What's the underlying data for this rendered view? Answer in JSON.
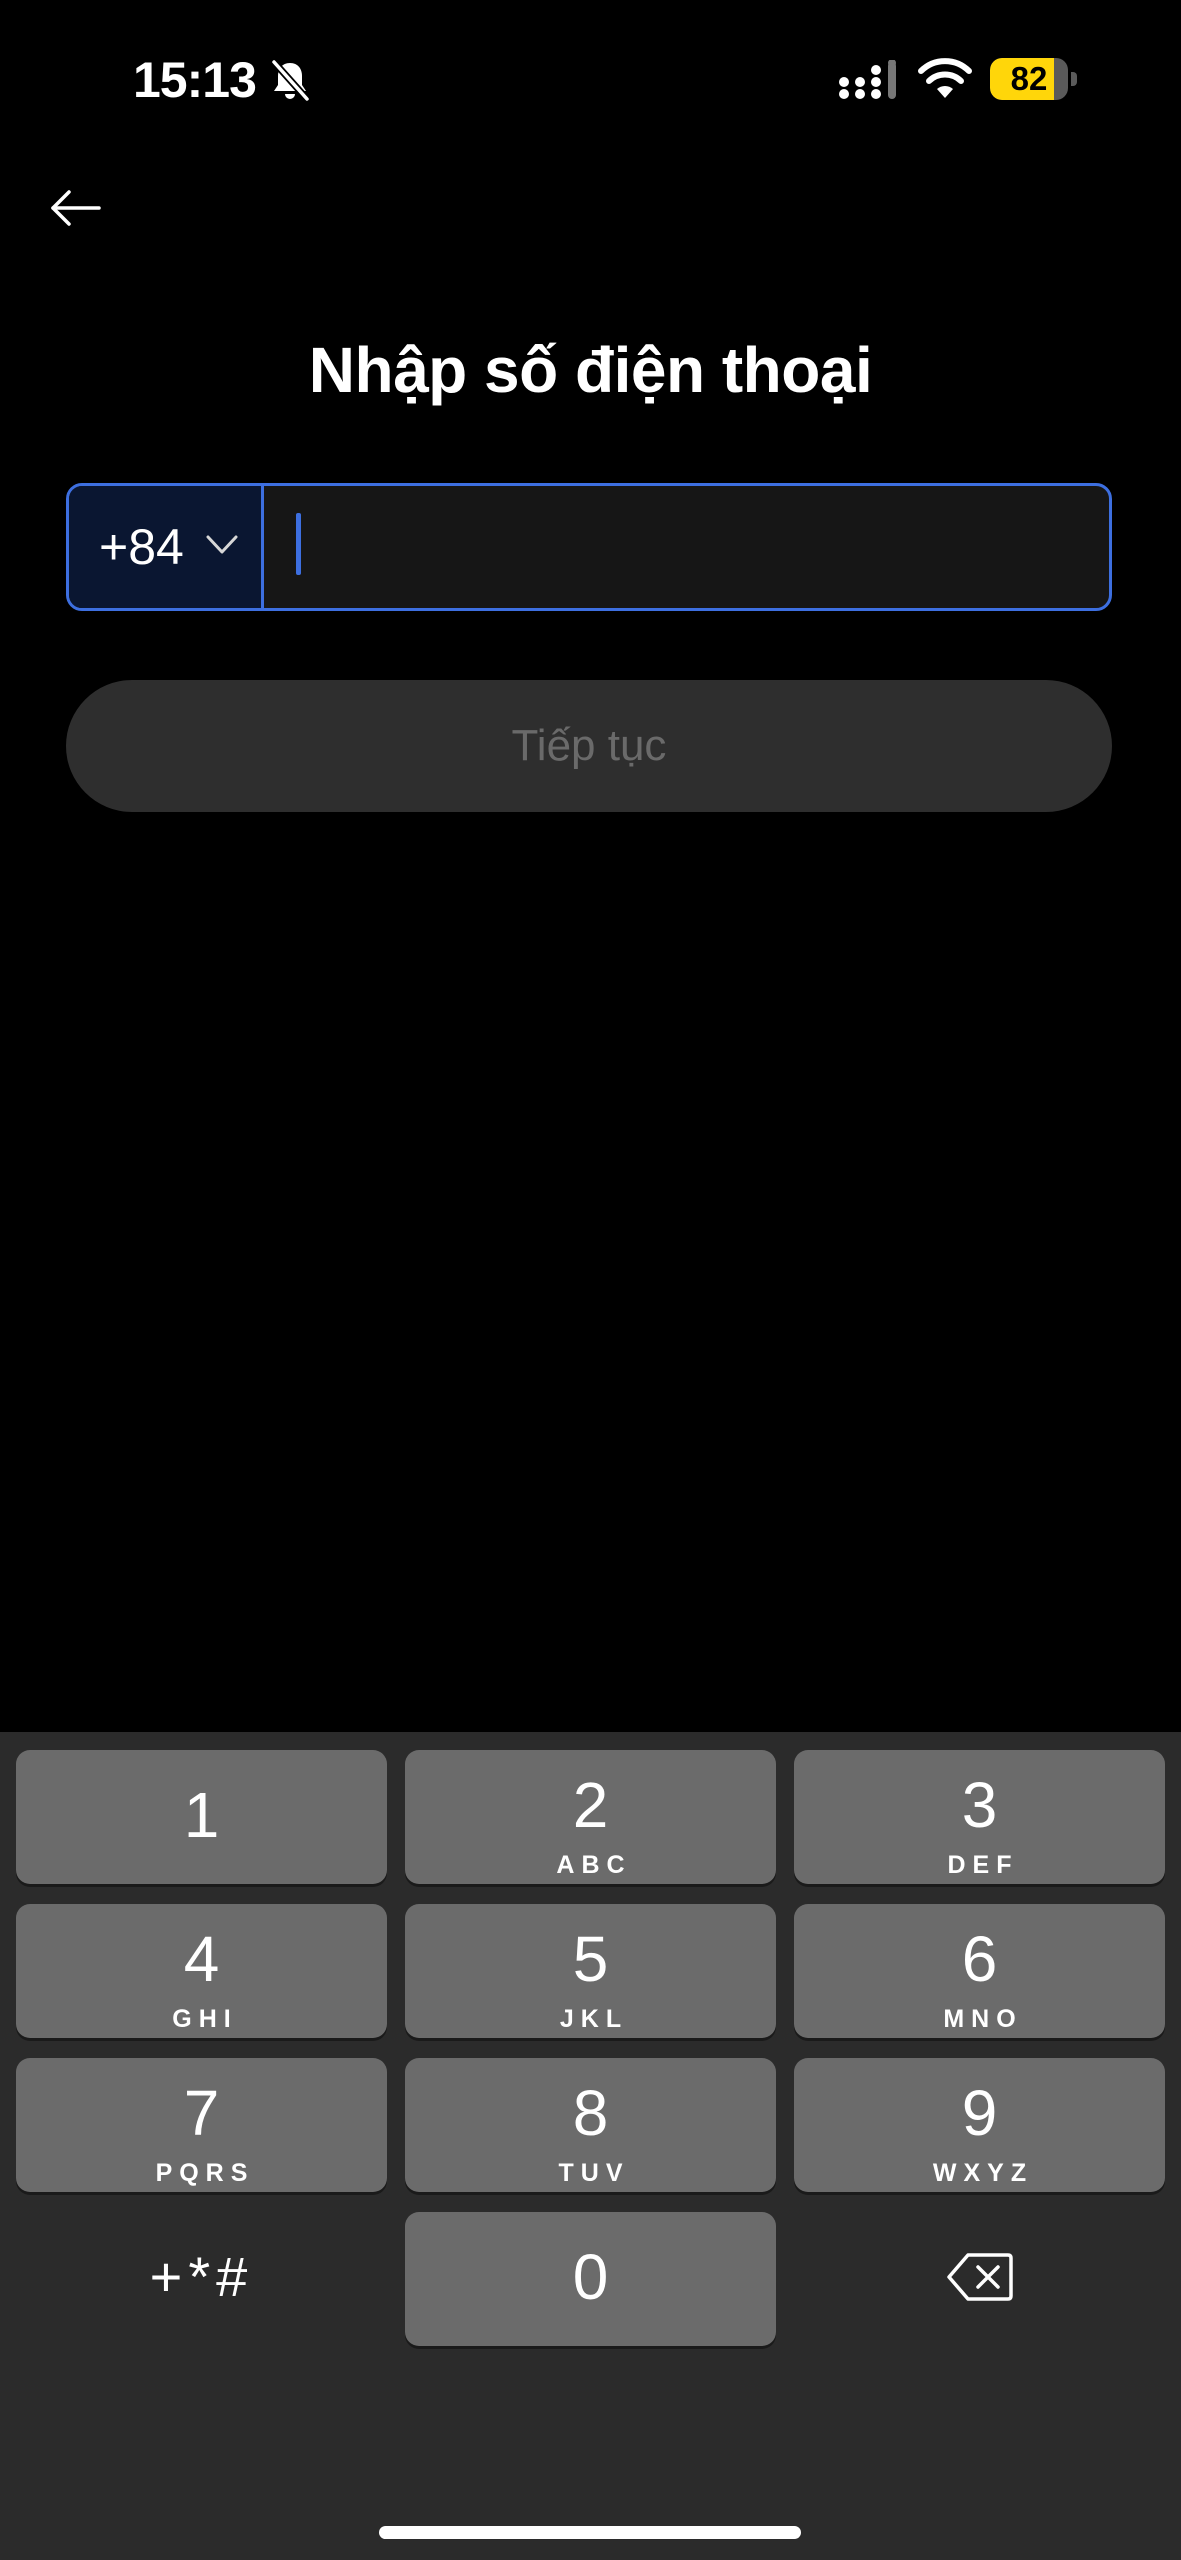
{
  "status_bar": {
    "time": "15:13",
    "battery_level": "82",
    "battery_fraction": 0.82,
    "icons": [
      "bell-slash-icon",
      "signal-icon",
      "wifi-icon",
      "battery-icon"
    ]
  },
  "header": {
    "back_icon": "arrow-left-icon",
    "title": "Nhập số điện thoại"
  },
  "phone_form": {
    "country_code": "+84",
    "country_chevron_icon": "chevron-down-icon",
    "phone_value": "",
    "continue_label": "Tiếp tục",
    "continue_enabled": false
  },
  "colors": {
    "accent": "#3d6fe0",
    "background": "#000000",
    "keypad_background": "#2b2b2b",
    "key": "#6b6b6b",
    "battery": "#ffd60a"
  },
  "keypad": {
    "keys": [
      {
        "digit": "1",
        "letters": ""
      },
      {
        "digit": "2",
        "letters": "ABC"
      },
      {
        "digit": "3",
        "letters": "DEF"
      },
      {
        "digit": "4",
        "letters": "GHI"
      },
      {
        "digit": "5",
        "letters": "JKL"
      },
      {
        "digit": "6",
        "letters": "MNO"
      },
      {
        "digit": "7",
        "letters": "PQRS"
      },
      {
        "digit": "8",
        "letters": "TUV"
      },
      {
        "digit": "9",
        "letters": "WXYZ"
      },
      {
        "digit": "0",
        "letters": ""
      }
    ],
    "symbols_label": "+*#",
    "backspace_icon": "backspace-icon"
  }
}
